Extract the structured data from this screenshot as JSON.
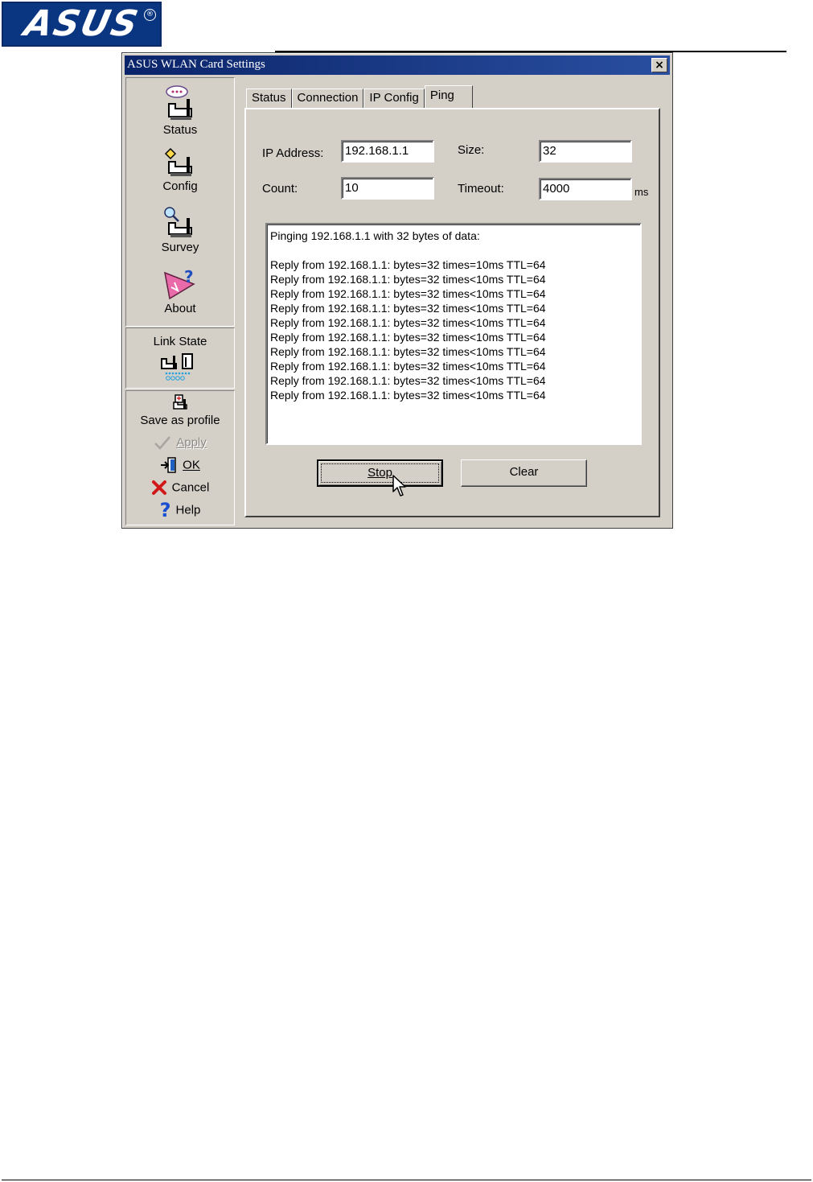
{
  "header": {
    "logo_text": "ASUS",
    "logo_mark": "®"
  },
  "window": {
    "title": "ASUS WLAN Card Settings",
    "close_label": "×"
  },
  "nav": {
    "items": [
      {
        "label": "Status",
        "icon": "status-router-icon"
      },
      {
        "label": "Config",
        "icon": "config-router-icon"
      },
      {
        "label": "Survey",
        "icon": "survey-router-icon"
      },
      {
        "label": "About",
        "icon": "about-icon"
      }
    ],
    "link_state": {
      "label": "Link State",
      "icon": "link-state-icon"
    }
  },
  "actions": {
    "save_profile": "Save as profile",
    "apply": "Apply",
    "ok": "OK",
    "cancel": "Cancel",
    "help": "Help"
  },
  "tabs": [
    {
      "label": "Status",
      "active": false
    },
    {
      "label": "Connection",
      "active": false
    },
    {
      "label": "IP Config",
      "active": false
    },
    {
      "label": "Ping",
      "active": true
    }
  ],
  "ping": {
    "ip_label": "IP Address:",
    "ip_value": "192.168.1.1",
    "size_label": "Size:",
    "size_value": "32",
    "count_label": "Count:",
    "count_value": "10",
    "timeout_label": "Timeout:",
    "timeout_value": "4000",
    "timeout_units": "ms",
    "output": [
      "Pinging 192.168.1.1 with 32 bytes of data:",
      "",
      "Reply from 192.168.1.1: bytes=32 times=10ms TTL=64",
      "Reply from 192.168.1.1: bytes=32 times<10ms TTL=64",
      "Reply from 192.168.1.1: bytes=32 times<10ms TTL=64",
      "Reply from 192.168.1.1: bytes=32 times<10ms TTL=64",
      "Reply from 192.168.1.1: bytes=32 times<10ms TTL=64",
      "Reply from 192.168.1.1: bytes=32 times<10ms TTL=64",
      "Reply from 192.168.1.1: bytes=32 times<10ms TTL=64",
      "Reply from 192.168.1.1: bytes=32 times<10ms TTL=64",
      "Reply from 192.168.1.1: bytes=32 times<10ms TTL=64",
      "Reply from 192.168.1.1: bytes=32 times<10ms TTL=64"
    ],
    "stop_label": "Stop",
    "clear_label": "Clear"
  },
  "colors": {
    "titlebar": "#0a246a",
    "face": "#d4d0c8",
    "logo_blue": "#0a3580"
  }
}
